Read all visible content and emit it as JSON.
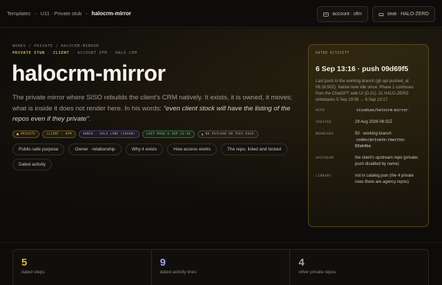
{
  "breadcrumb": [
    "Templates",
    "U11 · Private stub",
    "halocrm-mirror"
  ],
  "top_actions": [
    {
      "label": "account · ofm",
      "icon": "account-icon"
    },
    {
      "label": "seat · HALO-ZERO",
      "icon": "seat-icon"
    }
  ],
  "hero": {
    "path": "WORKS / PRIVATE / HALOCRM-MIRROR",
    "subline": [
      "PRIVATE STUB",
      "CLIENT",
      "ACCOUNT OFM",
      "HALO CRM"
    ],
    "title": "halocrm-mirror",
    "description_plain": "The private mirror where SISO rebuilds the client's CRM natively. It exists, it is owned, it moves; what is inside it does not render here. In his words: ",
    "description_quote": "\"even client stock will have the listing of the repos even if they private\"",
    "description_end": "."
  },
  "badges": [
    {
      "label": "PRIVATE",
      "style": "gold"
    },
    {
      "label": "CLIENT · OFM",
      "style": "gold"
    },
    {
      "label": "OWNER · HALO LANE (SHAAN)",
      "style": "purple"
    },
    {
      "label": "LAST PUSH 6 SEP 13:16",
      "style": "green"
    },
    {
      "label": "NO PAYLOAD ON THIS PAGE",
      "style": "grey"
    }
  ],
  "chips": [
    "Public-safe purpose",
    "Owner · relationship",
    "Why it exists",
    "How access works",
    "The repo, listed and locked",
    "Dated activity"
  ],
  "activity": {
    "heading": "DATED ACTIVITY",
    "title": "6 Sep 13:16 · push 09d69f5",
    "description": "Last push to the working branch (gh api pushed_at 06:16:50Z). Native lane idle since; Phase 1 continues from the ChatGPT web UI (D-21). 31 HALO-ZERO writebacks 5 Sep 19:58 → 6 Sep 13:17.",
    "rows": [
      {
        "key": "REPO",
        "code": "sisodias/halocrm-mirror",
        "text": ""
      },
      {
        "key": "CREATED",
        "code": "",
        "text": "29 Aug 2026 06:02Z"
      },
      {
        "key": "BRANCHES",
        "text": "50 · working branch",
        "code": "codex/private-rewrite-83ab4ba"
      },
      {
        "key": "UPSTREAM",
        "code": "",
        "text": "the client's upstream repo (private; push disabled by name)"
      },
      {
        "key": "LIBRARY",
        "code": "",
        "text": "not in catalog.json (the 4 private rows there are agency repos)"
      }
    ]
  },
  "stats": [
    {
      "value": "5",
      "label": "dated steps",
      "color": "#e0b53e"
    },
    {
      "value": "9",
      "label": "dated activity lines",
      "color": "#a99cf0"
    },
    {
      "value": "4",
      "label": "other private repos",
      "color": "#a9a39a"
    }
  ]
}
